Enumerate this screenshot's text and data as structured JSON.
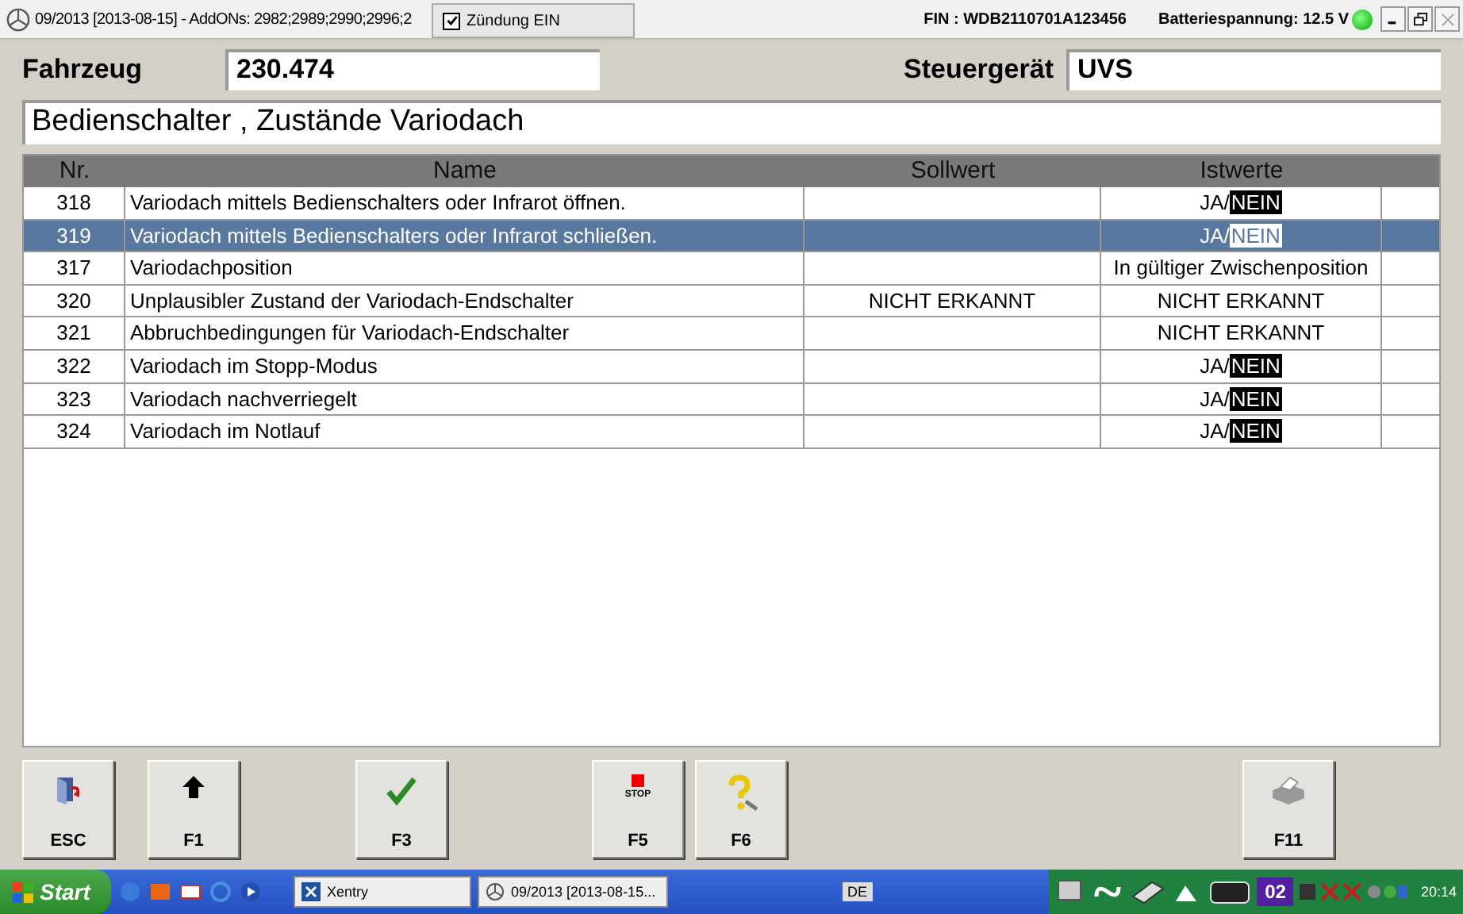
{
  "window": {
    "title": "09/2013 [2013-08-15] - AddONs: 2982;2989;2990;2996;2",
    "ignition": {
      "label": "Zündung EIN",
      "checked": true
    },
    "fin": "FIN : WDB2110701A123456",
    "battery": "Batteriespannung: 12.5 V"
  },
  "vehicle": {
    "label": "Fahrzeug",
    "value": "230.474"
  },
  "ecu": {
    "label": "Steuergerät",
    "value": "UVS"
  },
  "heading": "Bedienschalter , Zustände Variodach",
  "table": {
    "columns": [
      "Nr.",
      "Name",
      "Sollwert",
      "Istwerte"
    ],
    "rows": [
      {
        "nr": "318",
        "name": "Variodach mittels Bedienschalters oder Infrarot öffnen.",
        "soll": "",
        "ist": "JA/",
        "ist_mark": "NEIN",
        "selected": false
      },
      {
        "nr": "319",
        "name": "Variodach mittels Bedienschalters oder Infrarot schließen.",
        "soll": "",
        "ist": "JA/",
        "ist_mark": "NEIN",
        "selected": true
      },
      {
        "nr": "317",
        "name": "Variodachposition",
        "soll": "",
        "ist": "In gültiger Zwischenposition",
        "selected": false
      },
      {
        "nr": "320",
        "name": "Unplausibler Zustand der Variodach-Endschalter",
        "soll": "NICHT ERKANNT",
        "ist": "NICHT ERKANNT",
        "selected": false
      },
      {
        "nr": "321",
        "name": "Abbruchbedingungen für Variodach-Endschalter",
        "soll": "",
        "ist": "NICHT ERKANNT",
        "selected": false
      },
      {
        "nr": "322",
        "name": "Variodach im Stopp-Modus",
        "soll": "",
        "ist": "JA/",
        "ist_mark": "NEIN",
        "selected": false
      },
      {
        "nr": "323",
        "name": "Variodach nachverriegelt",
        "soll": "",
        "ist": "JA/",
        "ist_mark": "NEIN",
        "selected": false
      },
      {
        "nr": "324",
        "name": "Variodach im Notlauf",
        "soll": "",
        "ist": "JA/",
        "ist_mark": "NEIN",
        "selected": false
      }
    ]
  },
  "buttons": [
    {
      "kind": "exit",
      "label": "ESC"
    },
    {
      "kind": "up",
      "label": "F1"
    },
    {
      "kind": "check",
      "label": "F3"
    },
    {
      "kind": "stop",
      "label": "F5",
      "icon_text": "STOP"
    },
    {
      "kind": "help",
      "label": "F6"
    },
    {
      "kind": "print",
      "label": "F11"
    }
  ],
  "taskbar": {
    "start": "Start",
    "tasks": [
      {
        "kind": "xentry",
        "label": "Xentry"
      },
      {
        "kind": "window",
        "label": "09/2013 [2013-08-15..."
      }
    ],
    "language": "DE",
    "badge": "02",
    "clock": "20:14"
  }
}
